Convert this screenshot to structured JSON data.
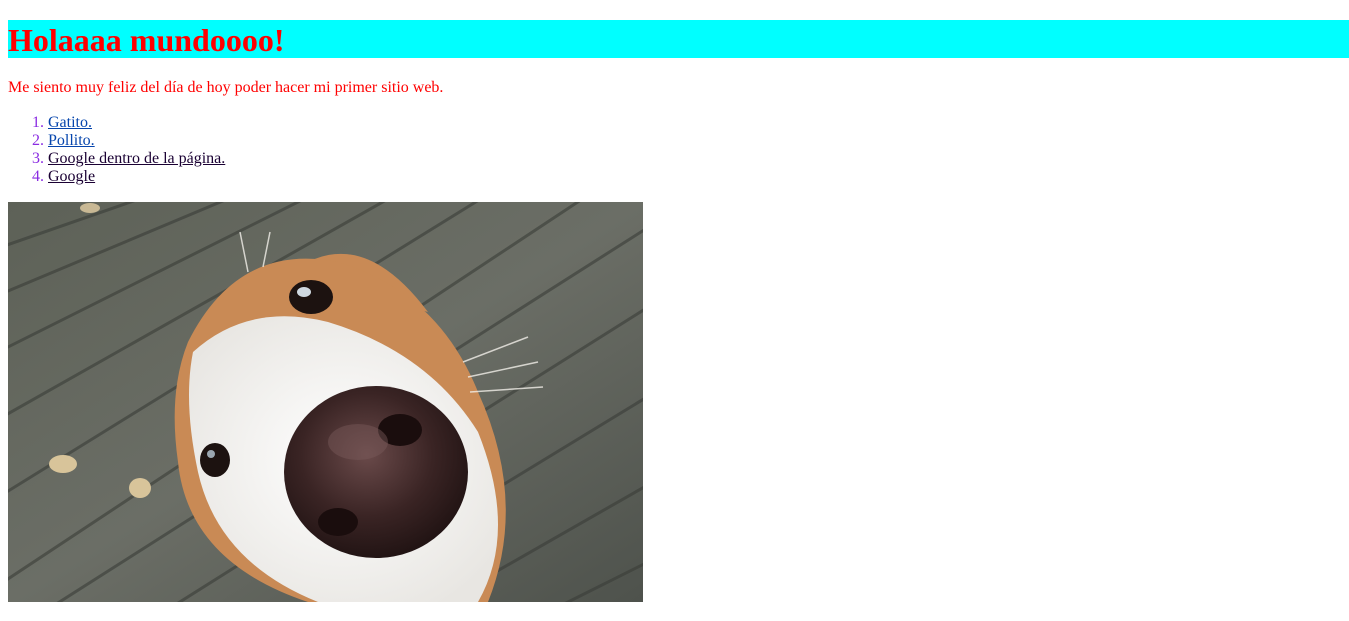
{
  "heading": "Holaaaa mundoooo!",
  "intro": "Me siento muy feliz del día de hoy poder hacer mi primer sitio web.",
  "links": [
    {
      "label": "Gatito."
    },
    {
      "label": "Pollito."
    },
    {
      "label": "Google dentro de la página."
    },
    {
      "label": "Google"
    }
  ],
  "colors": {
    "heading_text": "#ff0000",
    "heading_bg": "#00ffff",
    "intro_text": "#ff0000",
    "list_markers": "#8a2be2",
    "link": "#0645ad",
    "visited_link": "#1a0033"
  }
}
